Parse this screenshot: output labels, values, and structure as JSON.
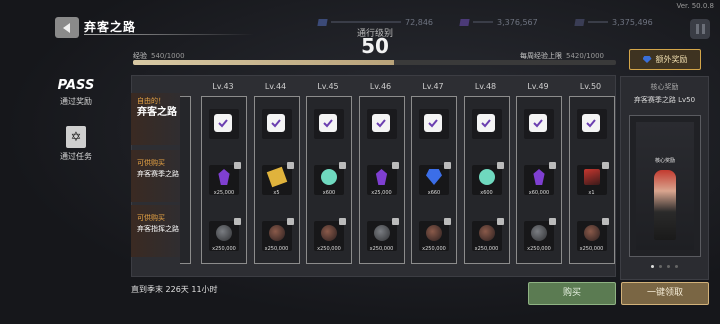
{
  "header": {
    "title": "弃客之路",
    "version": "Ver. 50.0.8",
    "resources": [
      "72,846",
      "3,376,567",
      "3,375,496"
    ]
  },
  "level": {
    "label": "通行级别",
    "value": "50"
  },
  "exp": {
    "label": "经验",
    "value": "540/1000",
    "progress": 0.54,
    "weekly_label": "每周经验上限",
    "weekly_value": "5420/1000"
  },
  "extra_reward_label": "额外奖励",
  "nav": {
    "pass_logo": "PASS",
    "pass_label": "通过奖励",
    "mission_label": "通过任务"
  },
  "rows": [
    {
      "tag": "自由的！",
      "name": "弃客之路"
    },
    {
      "tag": "可供购买",
      "name": "弃客赛季之路"
    },
    {
      "tag": "可供购买",
      "name": "弃客指挥之路"
    }
  ],
  "columns": [
    {
      "level": "Lv.43",
      "r2": {
        "icon": "purple-gem-icon",
        "qty": "x25,000"
      },
      "r3": {
        "icon": "bomb-icon",
        "qty": "x250,000"
      }
    },
    {
      "level": "Lv.44",
      "r2": {
        "icon": "ticket-icon",
        "qty": "x5"
      },
      "r3": {
        "icon": "bomb2-icon",
        "qty": "x250,000"
      }
    },
    {
      "level": "Lv.45",
      "r2": {
        "icon": "mint-orb-icon",
        "qty": "x600"
      },
      "r3": {
        "icon": "bomb2-icon",
        "qty": "x250,000"
      }
    },
    {
      "level": "Lv.46",
      "r2": {
        "icon": "purple-gem-icon",
        "qty": "x25,000"
      },
      "r3": {
        "icon": "bomb-icon",
        "qty": "x250,000"
      }
    },
    {
      "level": "Lv.47",
      "r2": {
        "icon": "blue-diamond-icon",
        "qty": "x660"
      },
      "r3": {
        "icon": "bomb2-icon",
        "qty": "x250,000"
      }
    },
    {
      "level": "Lv.48",
      "r2": {
        "icon": "mint-orb-icon",
        "qty": "x600"
      },
      "r3": {
        "icon": "bomb2-icon",
        "qty": "x250,000"
      }
    },
    {
      "level": "Lv.49",
      "r2": {
        "icon": "purple-gem-icon",
        "qty": "x60,000"
      },
      "r3": {
        "icon": "bomb-icon",
        "qty": "x250,000"
      }
    },
    {
      "level": "Lv.50",
      "r2": {
        "icon": "hero-portrait-icon",
        "qty": "x1"
      },
      "r3": {
        "icon": "bomb2-icon",
        "qty": "x250,000"
      }
    }
  ],
  "preview": {
    "title": "核心奖励",
    "subtitle": "弃客赛季之路 Lv50",
    "badge": "核心奖励"
  },
  "season_text": "直到季末 226天 11小时",
  "buttons": {
    "buy": "购买",
    "claim_all": "一键领取"
  }
}
